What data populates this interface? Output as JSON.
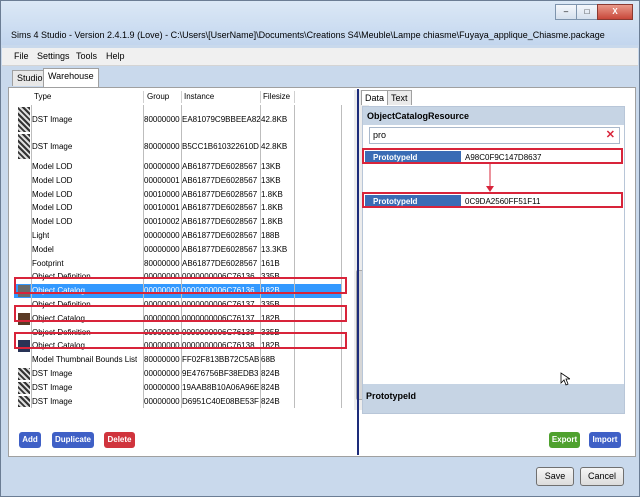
{
  "window": {
    "title": "Sims 4 Studio - Version 2.4.1.9  (Love)   - C:\\Users\\[UserName]\\Documents\\Creations S4\\Meuble\\Lampe chiasme\\Fuyaya_applique_Chiasme.package",
    "minimize": "–",
    "maximize": "□",
    "close": "X"
  },
  "menu": [
    "File",
    "Settings",
    "Tools",
    "Help"
  ],
  "tabs": [
    "Studio",
    "Warehouse"
  ],
  "grid": {
    "columns": [
      "Type",
      "Group",
      "Instance",
      "Filesize"
    ],
    "rows": [
      {
        "type": "DST Image",
        "group": "80000000",
        "instance": "EA81079C9BBEEA82",
        "size": "42.8KB",
        "thumb": "dst-image-thumbnail",
        "selected": false
      },
      {
        "type": "DST Image",
        "group": "80000000",
        "instance": "B5CC1B610322610D",
        "size": "42.8KB",
        "thumb": "dst-image-thumbnail",
        "selected": false
      },
      {
        "type": "Model LOD",
        "group": "00000000",
        "instance": "AB61877DE6028567",
        "size": "13KB",
        "thumb": "",
        "selected": false
      },
      {
        "type": "Model LOD",
        "group": "00000001",
        "instance": "AB61877DE6028567",
        "size": "13KB",
        "thumb": "",
        "selected": false
      },
      {
        "type": "Model LOD",
        "group": "00010000",
        "instance": "AB61877DE6028567",
        "size": "1.8KB",
        "thumb": "",
        "selected": false
      },
      {
        "type": "Model LOD",
        "group": "00010001",
        "instance": "AB61877DE6028567",
        "size": "1.8KB",
        "thumb": "",
        "selected": false
      },
      {
        "type": "Model LOD",
        "group": "00010002",
        "instance": "AB61877DE6028567",
        "size": "1.8KB",
        "thumb": "",
        "selected": false
      },
      {
        "type": "Light",
        "group": "00000000",
        "instance": "AB61877DE6028567",
        "size": "188B",
        "thumb": "",
        "selected": false
      },
      {
        "type": "Model",
        "group": "00000000",
        "instance": "AB61877DE6028567",
        "size": "13.3KB",
        "thumb": "",
        "selected": false
      },
      {
        "type": "Footprint",
        "group": "80000000",
        "instance": "AB61877DE6028567",
        "size": "161B",
        "thumb": "",
        "selected": false
      },
      {
        "type": "Object Definition",
        "group": "00000000",
        "instance": "0000000006C76136",
        "size": "335B",
        "thumb": "",
        "selected": false
      },
      {
        "type": "Object Catalog",
        "group": "00000000",
        "instance": "0000000006C76136",
        "size": "182B",
        "thumb": "catalog-swatch-gray",
        "selected": true
      },
      {
        "type": "Object Definition",
        "group": "00000000",
        "instance": "0000000006C76137",
        "size": "335B",
        "thumb": "",
        "selected": false
      },
      {
        "type": "Object Catalog",
        "group": "00000000",
        "instance": "0000000006C76137",
        "size": "182B",
        "thumb": "catalog-swatch-brown",
        "selected": false
      },
      {
        "type": "Object Definition",
        "group": "00000000",
        "instance": "0000000006C76138",
        "size": "335B",
        "thumb": "",
        "selected": false
      },
      {
        "type": "Object Catalog",
        "group": "00000000",
        "instance": "0000000006C76138",
        "size": "182B",
        "thumb": "catalog-swatch-navy",
        "selected": false
      },
      {
        "type": "Model Thumbnail Bounds List",
        "group": "80000000",
        "instance": "FF02F813BB72C5AB",
        "size": "68B",
        "thumb": "",
        "selected": false
      },
      {
        "type": "DST Image",
        "group": "00000000",
        "instance": "9E476756BF38EDB3",
        "size": "824B",
        "thumb": "dst-image-thumbnail",
        "selected": false
      },
      {
        "type": "DST Image",
        "group": "00000000",
        "instance": "19AAB8B10A06A96E",
        "size": "824B",
        "thumb": "dst-image-thumbnail",
        "selected": false
      },
      {
        "type": "DST Image",
        "group": "00000000",
        "instance": "D6951C40E08BE53F",
        "size": "824B",
        "thumb": "dst-image-thumbnail",
        "selected": false
      }
    ]
  },
  "actions": {
    "add": "Add",
    "duplicate": "Duplicate",
    "delete": "Delete",
    "export": "Export",
    "import": "Import"
  },
  "right": {
    "tabs": [
      "Data",
      "Text"
    ],
    "header": "ObjectCatalogResource",
    "search_value": "pro",
    "clear_icon": "✕",
    "properties": [
      {
        "label": "PrototypeId",
        "value": "A98C0F9C147D8637"
      },
      {
        "label": "PrototypeId",
        "value": "0C9DA2560FF51F11"
      }
    ],
    "footer": "PrototypeId"
  },
  "dialog": {
    "save": "Save",
    "cancel": "Cancel"
  },
  "colors": {
    "selection": "#3399ff",
    "highlight": "#d8243a",
    "add": "#3f60c6",
    "delete": "#d0343d",
    "export": "#4fa12e",
    "import": "#3f60c6"
  }
}
